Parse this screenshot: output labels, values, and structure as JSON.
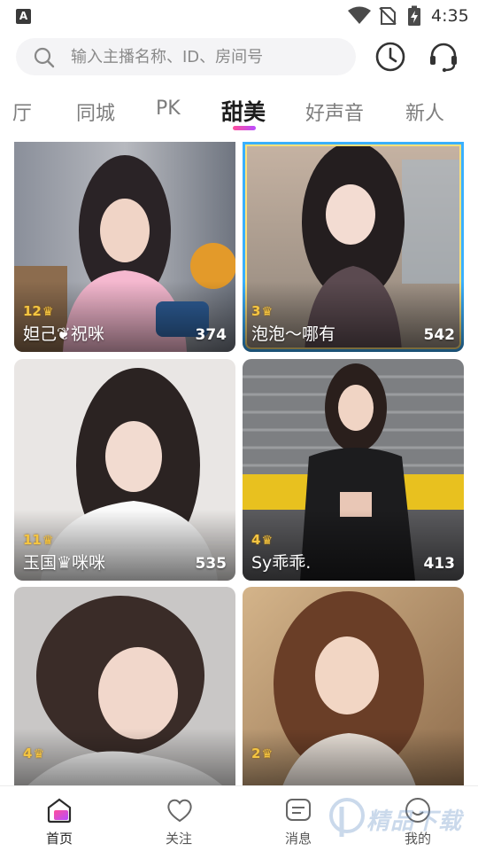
{
  "status_bar": {
    "app_icon_letter": "A",
    "time": "4:35"
  },
  "header": {
    "search_placeholder": "输入主播名称、ID、房间号",
    "history_icon": "clock-icon",
    "service_icon": "headset-icon"
  },
  "tabs": [
    {
      "label": "厅"
    },
    {
      "label": "同城"
    },
    {
      "label": "PK"
    },
    {
      "label": "甜美"
    },
    {
      "label": "好声音"
    },
    {
      "label": "新人"
    }
  ],
  "active_tab": "甜美",
  "colors": {
    "accent_gradient_start": "#ff4f9a",
    "accent_gradient_end": "#b94cff",
    "level_gold": "#f4c542",
    "highlight_frame": "#3ab0ff"
  },
  "streams": [
    {
      "level": "12",
      "name": "妲己❦祝咪",
      "viewers": "374"
    },
    {
      "level": "3",
      "name": "泡泡～哪有",
      "viewers": "542"
    },
    {
      "level": "11",
      "name": "玉国♛咪咪",
      "viewers": "535"
    },
    {
      "level": "4",
      "name": "Sy乖乖.",
      "viewers": "413"
    },
    {
      "level": "4",
      "name": "",
      "viewers": ""
    },
    {
      "level": "2",
      "name": "",
      "viewers": ""
    }
  ],
  "bottom_nav": [
    {
      "label": "首页",
      "icon": "home-icon"
    },
    {
      "label": "关注",
      "icon": "heart-icon"
    },
    {
      "label": "消息",
      "icon": "message-icon"
    },
    {
      "label": "我的",
      "icon": "profile-icon"
    }
  ],
  "watermark_text": "精品下载"
}
